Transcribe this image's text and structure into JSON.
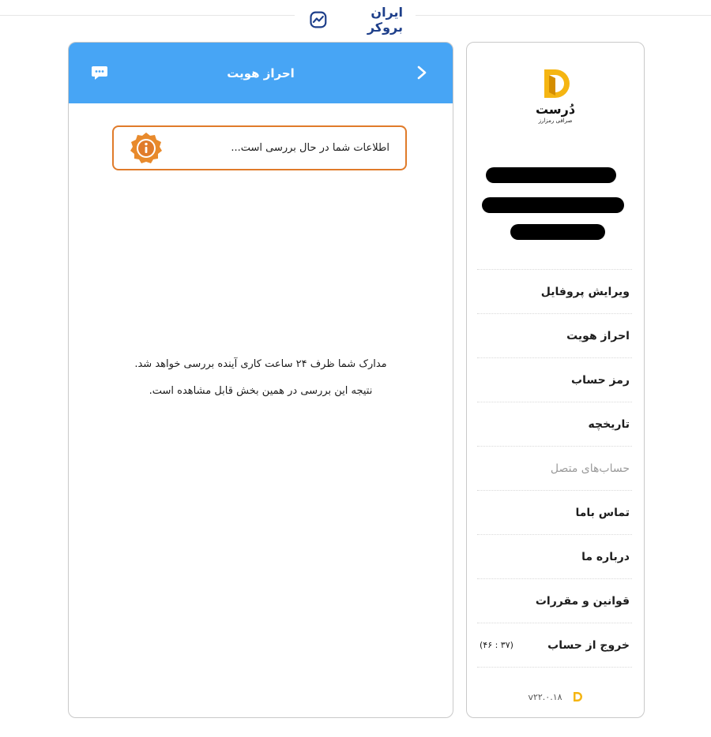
{
  "brand": {
    "name": "ایران بروکر",
    "icon": "trend-chart-icon",
    "color": "#1e3f8a"
  },
  "main": {
    "header": {
      "title": "احراز هویت",
      "back_icon": "chevron-right-icon",
      "chat_icon": "chat-bubble-icon",
      "color": "#47a5f5"
    },
    "notice": {
      "text": "اطلاعات شما در حال بررسی است...",
      "icon": "info-badge-icon",
      "color": "#e07b2a"
    },
    "body_lines": [
      "مدارک شما ظرف ۲۴ ساعت کاری آینده بررسی خواهد شد.",
      "نتیجه این بررسی در همین بخش قابل مشاهده است."
    ]
  },
  "sidebar": {
    "logo": {
      "icon": "dorost-logo-icon",
      "title": "دُرست",
      "subtitle": "صرافی رمزارز",
      "color": "#f5b512"
    },
    "menu": [
      {
        "label": "ویرایش پروفایل",
        "enabled": true
      },
      {
        "label": "احراز هویت",
        "enabled": true
      },
      {
        "label": "رمز حساب",
        "enabled": true
      },
      {
        "label": "تاریخچه",
        "enabled": true
      },
      {
        "label": "حساب‌های متصل",
        "enabled": false
      },
      {
        "label": "تماس باما",
        "enabled": true
      },
      {
        "label": "درباره ما",
        "enabled": true
      },
      {
        "label": "قوانین و مقررات",
        "enabled": true
      },
      {
        "label": "خروج از حساب",
        "enabled": true,
        "timer": "(۴۶ : ۳۷)"
      }
    ],
    "version": "v۲۲.۰.۱۸"
  }
}
